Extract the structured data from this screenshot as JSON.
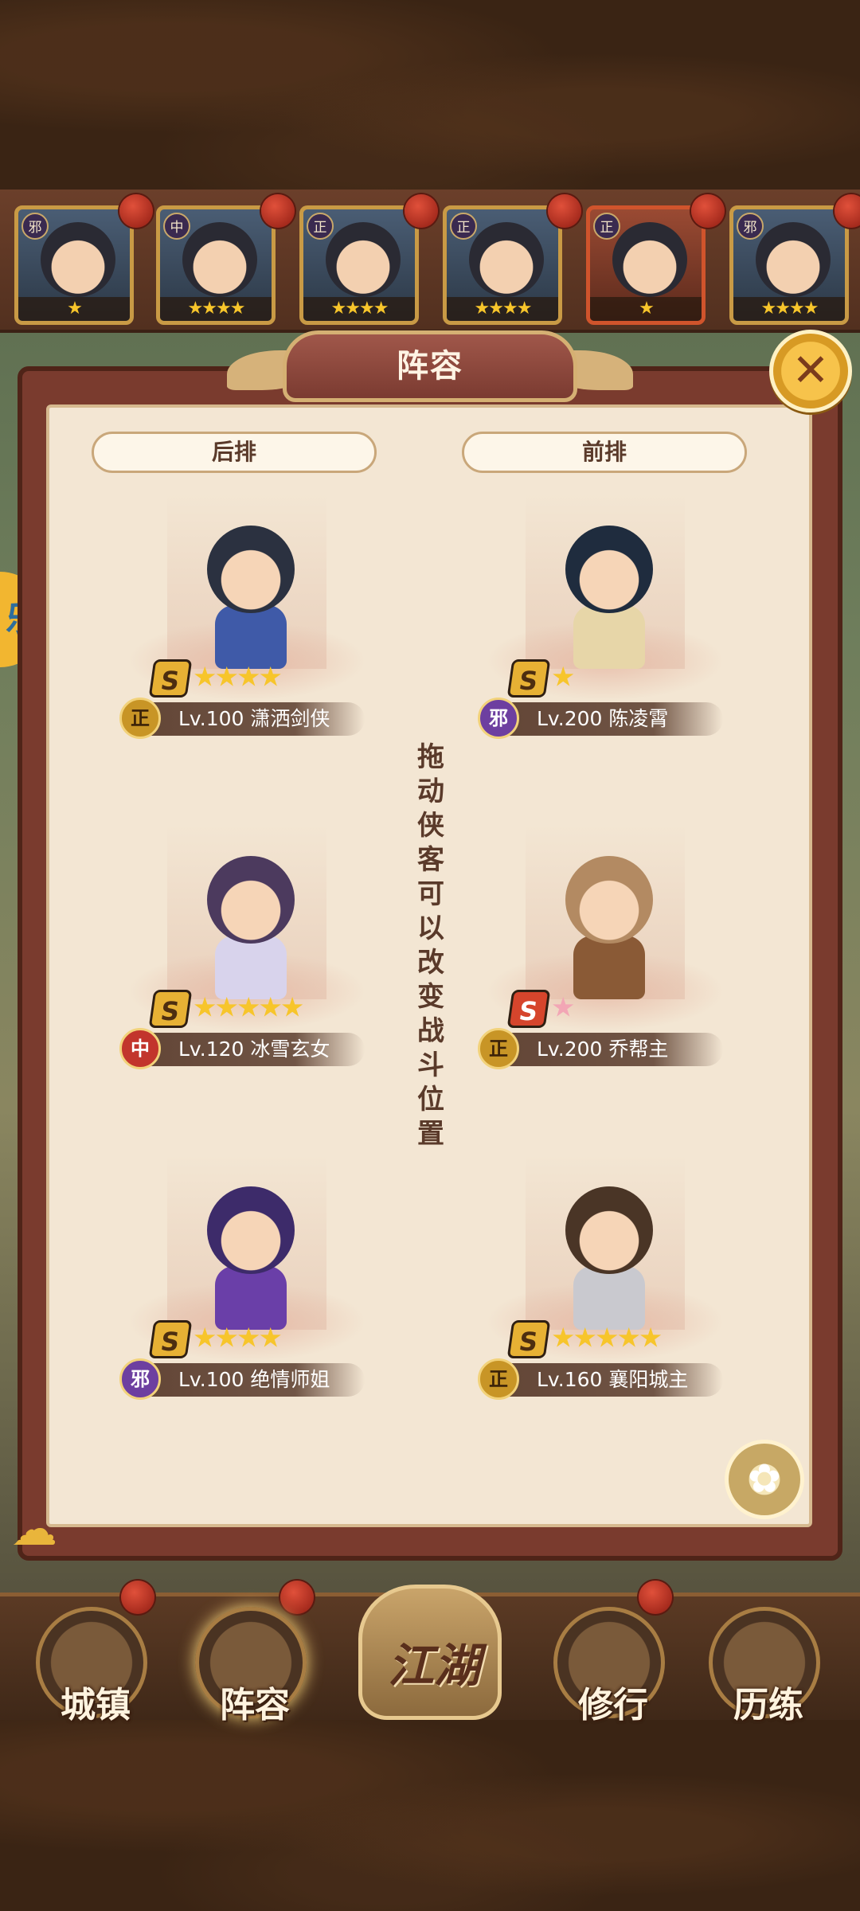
{
  "hero_strip": [
    {
      "faction": "邪",
      "stars": "★",
      "style": "normal"
    },
    {
      "faction": "中",
      "stars": "★★★★",
      "style": "normal"
    },
    {
      "faction": "正",
      "stars": "★★★★",
      "style": "normal"
    },
    {
      "faction": "正",
      "stars": "★★★★",
      "style": "normal"
    },
    {
      "faction": "正",
      "stars": "★",
      "style": "red"
    },
    {
      "faction": "邪",
      "stars": "★★★★",
      "style": "normal"
    }
  ],
  "panel": {
    "title": "阵容",
    "close_icon": "close-icon",
    "back_row_label": "后排",
    "front_row_label": "前排",
    "hint": "拖动侠客可以改变战斗位置"
  },
  "back_row": [
    {
      "faction": "正",
      "level": "Lv.100",
      "name": "潇洒剑侠",
      "grade": "S",
      "stars": "★★★★",
      "rank_style": "gold"
    },
    {
      "faction": "中",
      "level": "Lv.120",
      "name": "冰雪玄女",
      "grade": "S",
      "stars": "★★★★★",
      "rank_style": "gold"
    },
    {
      "faction": "邪",
      "level": "Lv.100",
      "name": "绝情师姐",
      "grade": "S",
      "stars": "★★★★",
      "rank_style": "gold"
    }
  ],
  "front_row": [
    {
      "faction": "邪",
      "level": "Lv.200",
      "name": "陈凌霄",
      "grade": "S",
      "stars": "★",
      "rank_style": "gold"
    },
    {
      "faction": "正",
      "level": "Lv.200",
      "name": "乔帮主",
      "grade": "S",
      "stars": "★",
      "rank_style": "red"
    },
    {
      "faction": "正",
      "level": "Lv.160",
      "name": "襄阳城主",
      "grade": "S",
      "stars": "★★★★★",
      "rank_style": "gold"
    }
  ],
  "side_chip": "乐",
  "bottom_nav": {
    "town": "城镇",
    "lineup": "阵容",
    "jianghu": "江湖",
    "cultivate": "修行",
    "training": "历练"
  },
  "colors": {
    "panel_bg": "#f3e6d3",
    "frame": "#7a3b2e",
    "gold": "#f7c52b",
    "faction_zheng": "#c89526",
    "faction_xie": "#6d3fa0",
    "faction_zhong": "#c2352c"
  }
}
